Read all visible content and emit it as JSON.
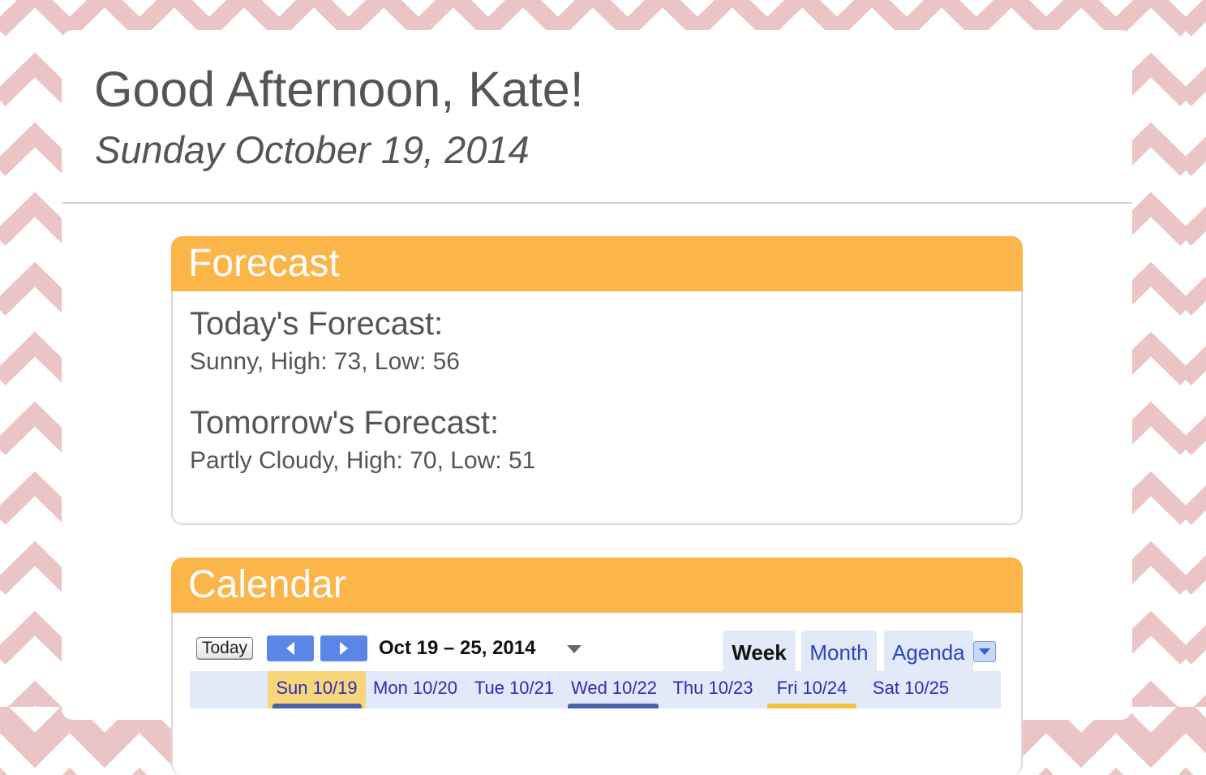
{
  "greeting": "Good Afternoon, Kate!",
  "date": "Sunday October 19, 2014",
  "forecast": {
    "title": "Forecast",
    "today_title": "Today's Forecast:",
    "today_detail": "Sunny, High: 73, Low: 56",
    "tomorrow_title": "Tomorrow's Forecast:",
    "tomorrow_detail": "Partly Cloudy, High: 70, Low: 51"
  },
  "calendar": {
    "title": "Calendar",
    "today_label": "Today",
    "prev_icon": "chevron-left-icon",
    "next_icon": "chevron-right-icon",
    "range": "Oct 19 – 25, 2014",
    "views": [
      "Week",
      "Month",
      "Agenda"
    ],
    "active_view": "Week",
    "days": [
      "Sun 10/19",
      "Mon 10/20",
      "Tue 10/21",
      "Wed 10/22",
      "Thu 10/23",
      "Fri 10/24",
      "Sat 10/25"
    ],
    "today_day": "Sun 10/19"
  },
  "colors": {
    "accent": "#fbb548",
    "background_pattern": "#ebc4c6",
    "nav_button": "#5a87e6",
    "today_highlight": "#f8d67a",
    "link_blue": "#2b2bb8"
  }
}
